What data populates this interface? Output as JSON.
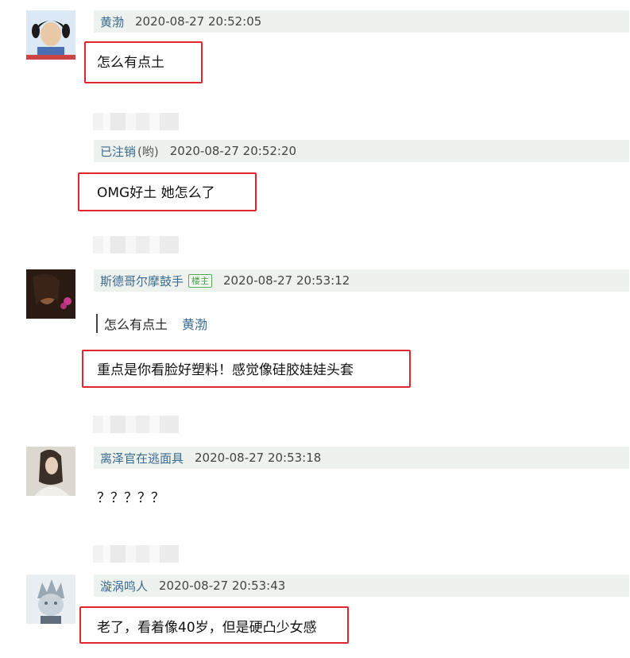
{
  "comments": [
    {
      "author": "黄渤",
      "time": "2020-08-27 20:52:05",
      "text": "怎么有点土",
      "avatar_colors": [
        "#dbe9f6",
        "#4a6fb3",
        "#e9c9a6"
      ]
    },
    {
      "author": "已注销",
      "author_suffix": "(哟)",
      "time": "2020-08-27 20:52:20",
      "text": "OMG好土 她怎么了"
    },
    {
      "author": "斯德哥尔摩鼓手",
      "badge": "楼主",
      "time": "2020-08-27 20:53:12",
      "quote": {
        "text": "怎么有点土",
        "author": "黄渤"
      },
      "text": "重点是你看脸好塑料！感觉像硅胶娃娃头套",
      "avatar_colors": [
        "#2a1a12",
        "#8a5a3a",
        "#c83a8a"
      ]
    },
    {
      "author": "离泽官在逃面具",
      "time": "2020-08-27 20:53:18",
      "text": "？？？？？",
      "avatar_colors": [
        "#dcd8cf",
        "#3a3028",
        "#f1efe9"
      ]
    },
    {
      "author": "漩涡鸣人",
      "time": "2020-08-27 20:53:43",
      "text": "老了，看着像40岁，但是硬凸少女感",
      "avatar_colors": [
        "#e8eef2",
        "#9aa8b4",
        "#5e6e7c"
      ]
    }
  ],
  "colors": {
    "header_bg": "#edf2ee",
    "author": "#3d6b8f",
    "highlight": "#e3262c",
    "badge": "#4a9a4a"
  }
}
